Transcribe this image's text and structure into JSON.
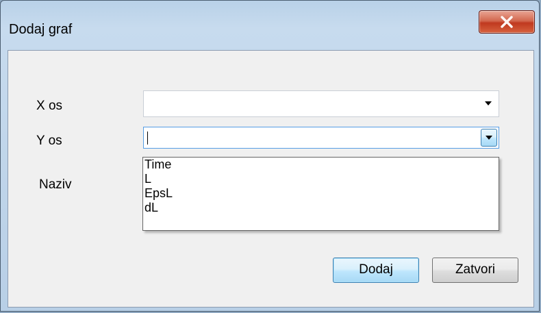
{
  "window": {
    "title": "Dodaj graf"
  },
  "form": {
    "x_axis_label": "X os",
    "y_axis_label": "Y os",
    "name_label": "Naziv",
    "x_axis_value": "",
    "y_axis_value": ""
  },
  "dropdown": {
    "options": [
      "Time",
      "L",
      "EpsL",
      "dL"
    ]
  },
  "buttons": {
    "add_label": "Dodaj",
    "close_label": "Zatvori"
  },
  "icons": {
    "close": "close-x-icon",
    "dropdown": "chevron-down-icon"
  }
}
